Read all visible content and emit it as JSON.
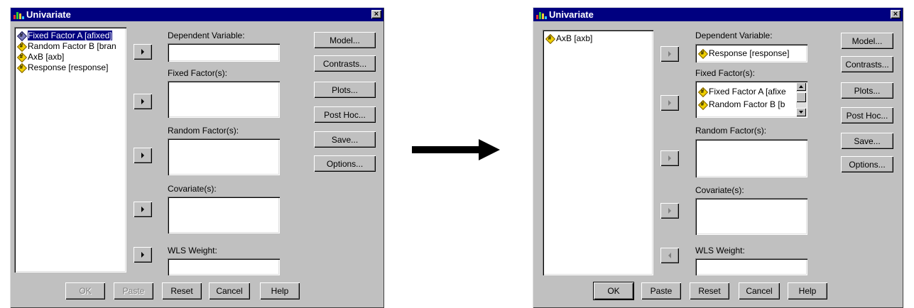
{
  "left_dialog": {
    "title": "Univariate",
    "source_list": [
      {
        "label": "Fixed Factor A [afixed]",
        "type": "fixed",
        "selected": true
      },
      {
        "label": "Random Factor B [bran",
        "type": "numeric",
        "selected": false
      },
      {
        "label": "AxB [axb]",
        "type": "numeric",
        "selected": false
      },
      {
        "label": "Response [response]",
        "type": "numeric",
        "selected": false
      }
    ],
    "dependent_label": "Dependent Variable:",
    "fixed_label": "Fixed Factor(s):",
    "random_label": "Random Factor(s):",
    "covariate_label": "Covariate(s):",
    "wls_label": "WLS Weight:",
    "side_buttons": {
      "model": "Model...",
      "contrasts": "Contrasts...",
      "plots": "Plots...",
      "posthoc": "Post Hoc...",
      "save": "Save...",
      "options": "Options..."
    },
    "bottom_buttons": {
      "ok": "OK",
      "paste": "Paste",
      "reset": "Reset",
      "cancel": "Cancel",
      "help": "Help"
    }
  },
  "right_dialog": {
    "title": "Univariate",
    "source_list": [
      {
        "label": "AxB [axb]",
        "type": "numeric"
      }
    ],
    "dependent_label": "Dependent Variable:",
    "dependent_value": "Response [response]",
    "fixed_label": "Fixed Factor(s):",
    "fixed_values": [
      "Fixed Factor A [afixe",
      "Random Factor B [b"
    ],
    "random_label": "Random Factor(s):",
    "covariate_label": "Covariate(s):",
    "wls_label": "WLS Weight:",
    "side_buttons": {
      "model": "Model...",
      "contrasts": "Contrasts...",
      "plots": "Plots...",
      "posthoc": "Post Hoc...",
      "save": "Save...",
      "options": "Options..."
    },
    "bottom_buttons": {
      "ok": "OK",
      "paste": "Paste",
      "reset": "Reset",
      "cancel": "Cancel",
      "help": "Help"
    }
  },
  "colors": {
    "dialog_bg": "#c0c0c0",
    "titlebar": "#000080",
    "selection": "#000080"
  },
  "icons": {
    "transition": "right-arrow-icon",
    "variable": "numeric-variable-icon"
  }
}
